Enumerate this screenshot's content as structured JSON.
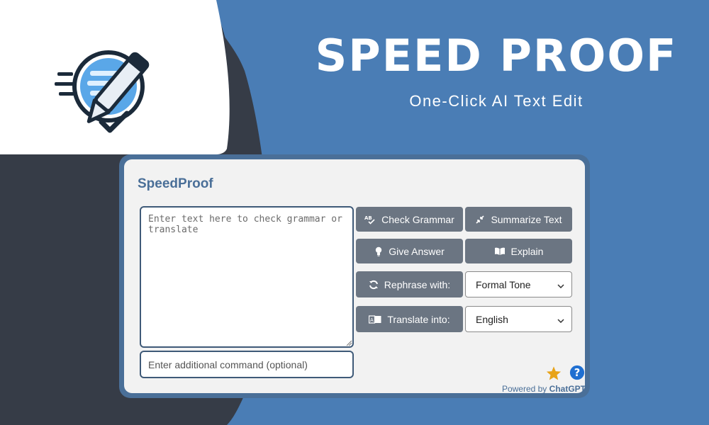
{
  "hero": {
    "title": "SPEED PROOF",
    "subtitle": "One-Click AI Text Edit"
  },
  "app": {
    "title": "SpeedProof",
    "main_input": {
      "placeholder": "Enter text here to check grammar or translate",
      "value": ""
    },
    "command_input": {
      "placeholder": "Enter additional command (optional)",
      "value": ""
    },
    "buttons": {
      "check_grammar": {
        "label": "Check Grammar",
        "icon": "ab-spellcheck-icon"
      },
      "summarize": {
        "label": "Summarize Text",
        "icon": "compress-icon"
      },
      "give_answer": {
        "label": "Give Answer",
        "icon": "lightbulb-icon"
      },
      "explain": {
        "label": "Explain",
        "icon": "open-book-icon"
      },
      "rephrase": {
        "label": "Rephrase with:",
        "icon": "sync-icon"
      },
      "translate": {
        "label": "Translate into:",
        "icon": "translate-icon"
      }
    },
    "tone_select": {
      "selected": "Formal Tone"
    },
    "language_select": {
      "selected": "English"
    },
    "footer": {
      "powered_prefix": "Powered by",
      "powered_brand": "ChatGPT"
    }
  },
  "colors": {
    "background": "#4a7db5",
    "card_frame": "#4a6f98",
    "button": "#6b7582",
    "star": "#e8a317",
    "help": "#1f6fd1"
  }
}
